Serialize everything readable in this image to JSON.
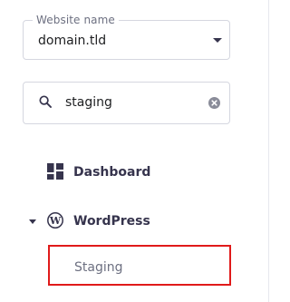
{
  "website_select": {
    "label": "Website name",
    "value": "domain.tld"
  },
  "search": {
    "value": "staging",
    "icon": "search-icon",
    "clear_icon": "clear-icon"
  },
  "nav": {
    "dashboard": {
      "label": "Dashboard",
      "icon": "dashboard-icon"
    },
    "wordpress": {
      "label": "WordPress",
      "icon": "wordpress-icon",
      "expanded": true,
      "children": [
        {
          "label": "Staging",
          "highlighted": true
        }
      ]
    }
  },
  "colors": {
    "text": "#36344d",
    "muted": "#6d7081",
    "border": "#d5d7e0",
    "highlight": "#e01a1a"
  }
}
